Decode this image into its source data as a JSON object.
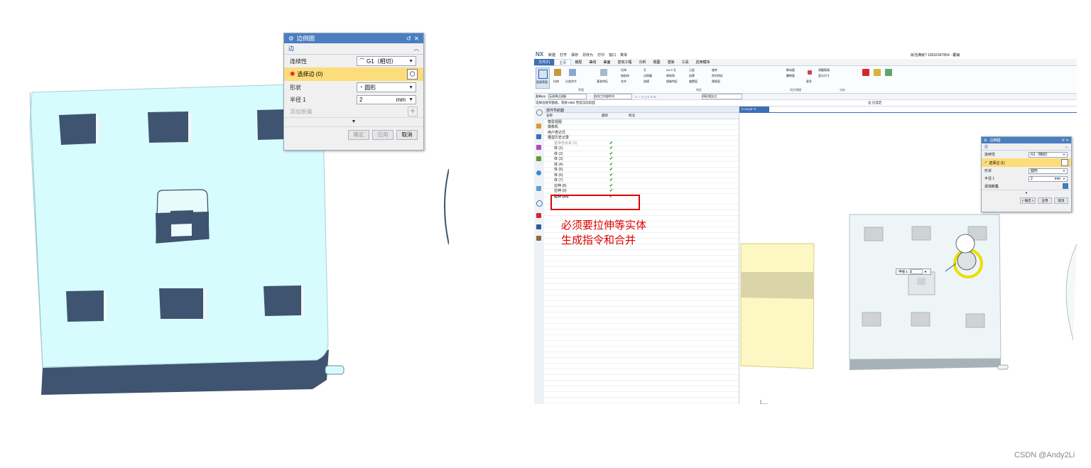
{
  "left_dialog": {
    "title": "边倒圆",
    "section": "边",
    "continuity_label": "连续性",
    "continuity_value": "G1（相切）",
    "select_edge_label": "选择边 (0)",
    "shape_label": "形状",
    "shape_value": "圆形",
    "radius_label": "半径 1",
    "radius_value": "2",
    "radius_unit": "mm",
    "add_set_label": "添加新集",
    "ok_label": "确定",
    "apply_label": "应用",
    "cancel_label": "取消"
  },
  "nx_window": {
    "logo": "NX",
    "quick_access": [
      "新建",
      "打开",
      "保存",
      "另存为",
      "打印",
      "窗口",
      "菜单"
    ],
    "title_right": "就活满就? 18316347854 - 覆铺",
    "menu_tabs": [
      "文件(F)",
      "主页",
      "装配",
      "曲线",
      "曲面",
      "逆向工程",
      "分析",
      "视图",
      "渲染",
      "工具",
      "应用模块"
    ],
    "active_tab": "主页",
    "ribbon_big_buttons": [
      "直接草图",
      "拉伸",
      "分类命令",
      "基准特征",
      "更多"
    ],
    "ribbon_groups": [
      "草图",
      "特征",
      "同步建模",
      "分析"
    ],
    "ribbon_small": [
      "拉伸",
      "孔",
      "NX 5 孔",
      "凸起",
      "旋转",
      "抽取体",
      "边倒圆",
      "倒斜角",
      "加厚",
      "阵列特征",
      "合并",
      "拔模",
      "镜像特征",
      "偏置面",
      "替换面",
      "移动面",
      "删除面",
      "测量距离",
      "显示尺寸"
    ],
    "filter_bar": [
      "菜单(M)",
      "无选择过滤器",
      "仅在工作部件内",
      "停征相交点"
    ],
    "status_text": "选择边链到面板。或按 MB2 完成当前前面",
    "status_right": "边 已选定",
    "navigator_title": "部件导航器",
    "navigator_columns": [
      "名称",
      "最新",
      "附注"
    ],
    "tree_items": [
      {
        "label": "模型视图",
        "check": false
      },
      {
        "label": "摄像机",
        "check": false
      },
      {
        "label": "用户表达式",
        "check": false
      },
      {
        "label": "模型历史记录",
        "check": false
      },
      {
        "label": "基准坐标系 (0)",
        "check": true
      },
      {
        "label": "体 (1)",
        "check": true
      },
      {
        "label": "体 (2)",
        "check": true
      },
      {
        "label": "体 (3)",
        "check": true
      },
      {
        "label": "体 (4)",
        "check": true
      },
      {
        "label": "体 (5)",
        "check": true
      },
      {
        "label": "体 (6)",
        "check": true
      },
      {
        "label": "体 (7)",
        "check": true
      },
      {
        "label": "拉伸 (8)",
        "check": true
      },
      {
        "label": "拉伸 (9)",
        "check": true
      },
      {
        "label": "拉伸 (10)",
        "check": true
      }
    ],
    "part_tab": "2-14.prt",
    "note": [
      "必须要拉伸等实体",
      "生成指令和合并"
    ],
    "dialog": {
      "title": "边倒圆",
      "section": "边",
      "continuity_label": "连续性",
      "continuity_value": "G1（相切）",
      "select_edge_label": "选择边 (1)",
      "shape_label": "形状",
      "shape_value": "圆形",
      "radius_label": "半径 1",
      "radius_value": "2",
      "radius_unit": "mm",
      "add_set_label": "添加新集",
      "ok_label": "< 确定 >",
      "apply_label": "应用",
      "cancel_label": "取消"
    },
    "radius_popup_label": "半径 1",
    "radius_popup_value": "2"
  },
  "watermark": "CSDN @Andy2Li",
  "colors": {
    "part_face": "#d6fcfd",
    "part_side": "#3e5470",
    "title_blue": "#4a7ec0",
    "highlight": "#fddc7a",
    "note_red": "#e00000",
    "box_red": "#e00000",
    "accent_yellow": "#e8e000"
  }
}
